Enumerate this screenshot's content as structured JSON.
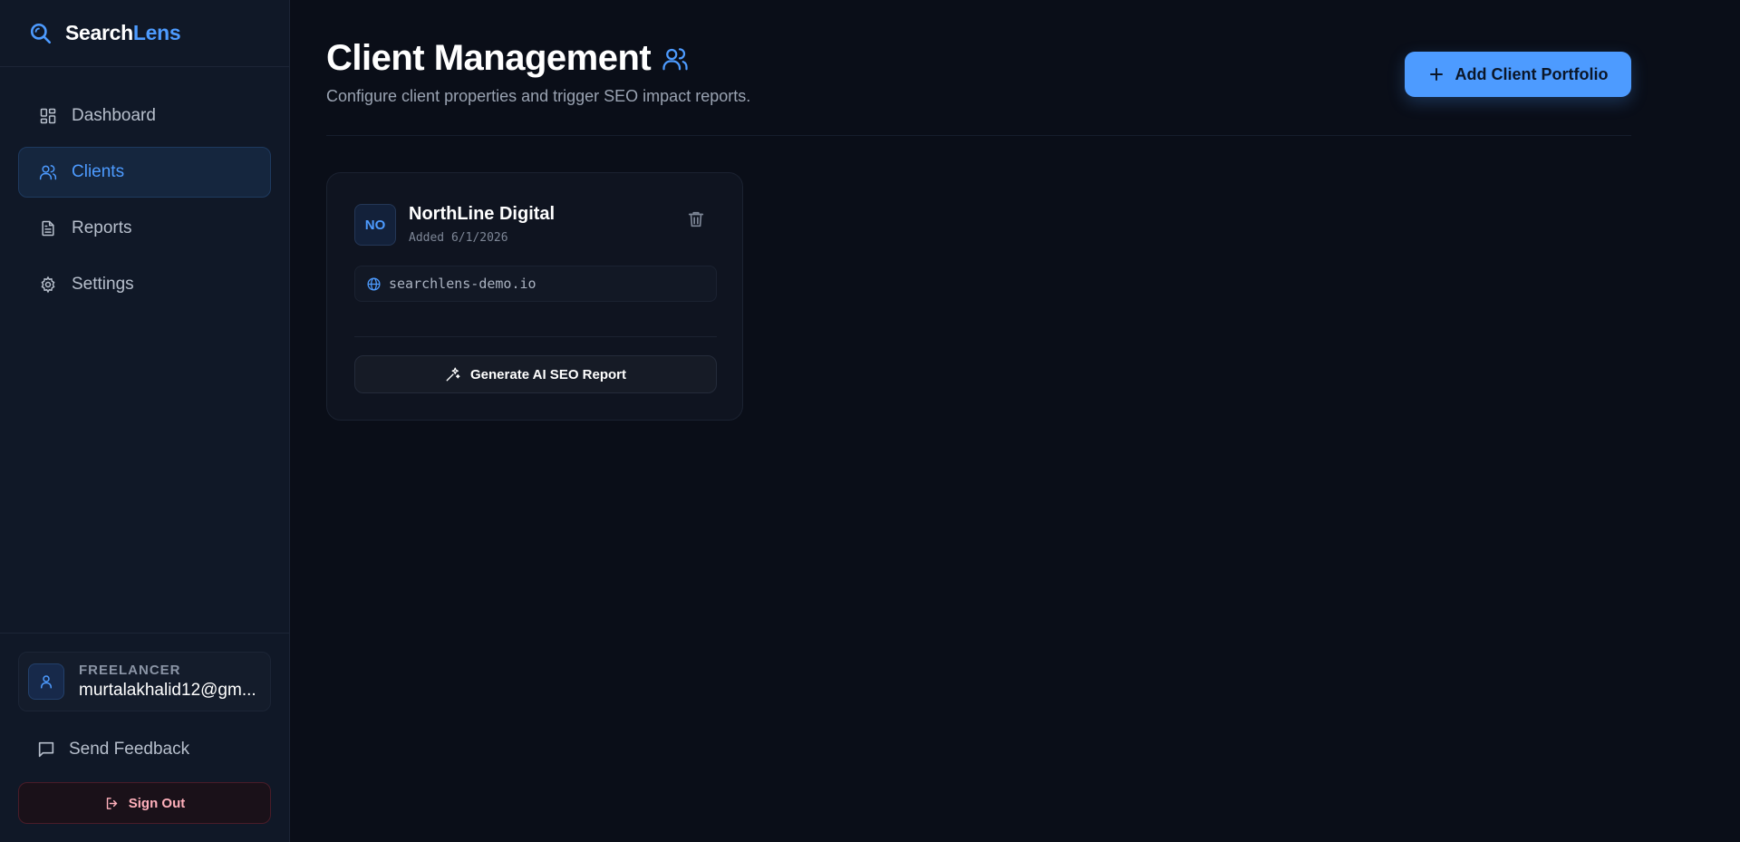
{
  "brand": {
    "part1": "Search",
    "part2": "Lens"
  },
  "nav": {
    "items": [
      {
        "label": "Dashboard",
        "icon": "dashboard-icon"
      },
      {
        "label": "Clients",
        "icon": "users-icon",
        "active": true
      },
      {
        "label": "Reports",
        "icon": "document-icon"
      },
      {
        "label": "Settings",
        "icon": "gear-icon"
      }
    ]
  },
  "user": {
    "role": "FREELANCER",
    "email": "murtalakhalid12@gm..."
  },
  "footer": {
    "feedback_label": "Send Feedback",
    "signout_label": "Sign Out"
  },
  "header": {
    "title": "Client Management",
    "subtitle": "Configure client properties and trigger SEO impact reports.",
    "add_button": "Add Client Portfolio"
  },
  "clients": [
    {
      "initials": "NO",
      "name": "NorthLine Digital",
      "added": "Added 6/1/2026",
      "url": "searchlens-demo.io",
      "generate_label": "Generate AI SEO Report"
    }
  ],
  "colors": {
    "accent": "#4d9bff",
    "background": "#0a0e18",
    "sidebar": "#101827",
    "danger": "#ffb0bb"
  }
}
